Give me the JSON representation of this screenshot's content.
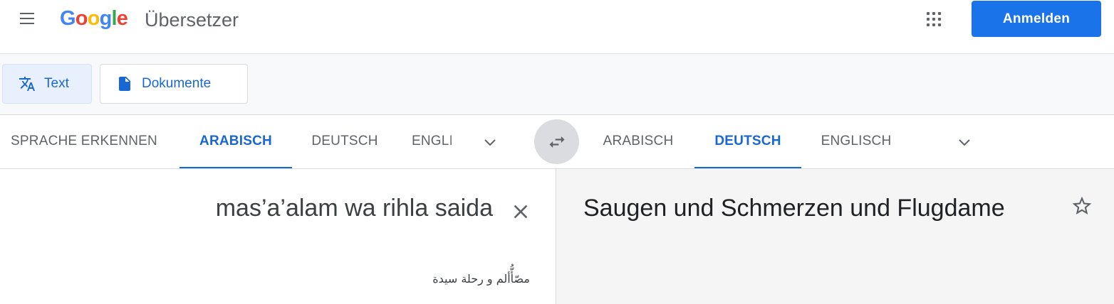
{
  "header": {
    "logo_letters": [
      "G",
      "o",
      "o",
      "g",
      "l",
      "e"
    ],
    "product_name": "Übersetzer",
    "signin_label": "Anmelden"
  },
  "modes": {
    "text_label": "Text",
    "documents_label": "Dokumente"
  },
  "source_languages": {
    "detect": "SPRACHE ERKENNEN",
    "tabs": [
      "ARABISCH",
      "DEUTSCH",
      "ENGLI"
    ],
    "active": "ARABISCH"
  },
  "target_languages": {
    "tabs": [
      "ARABISCH",
      "DEUTSCH",
      "ENGLISCH"
    ],
    "active": "DEUTSCH"
  },
  "source": {
    "text": "mas’a’alam wa rihla saida",
    "transliteration": "مصّأُّألم و رحلة سيدة"
  },
  "target": {
    "text": "Saugen und Schmerzen und Flugdame"
  },
  "colors": {
    "accent": "#1a73e8",
    "active_tab": "#1967d2",
    "inactive_text": "#5f6368",
    "divider": "#dadce0",
    "target_panel_bg": "#f5f5f5"
  },
  "icons": {
    "menu": "menu-icon",
    "apps": "apps-grid-icon",
    "text_mode": "translate-icon",
    "documents_mode": "document-icon",
    "more_languages": "chevron-down-icon",
    "swap": "swap-icon",
    "clear": "close-icon",
    "save": "star-icon"
  }
}
